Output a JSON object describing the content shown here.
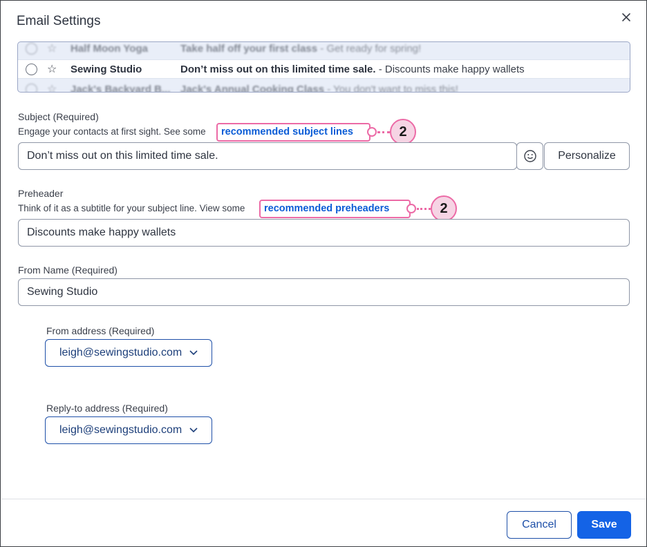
{
  "dialog": {
    "title": "Email Settings"
  },
  "preview": {
    "rows": [
      {
        "sender": "Half Moon Yoga",
        "subject": "Take half off your first class",
        "preheader": " - Get ready for spring!"
      },
      {
        "sender": "Sewing Studio",
        "subject": "Don’t miss out on this limited time sale.",
        "preheader": " - Discounts make happy wallets"
      },
      {
        "sender": "Jack's Backyard B...",
        "subject": "Jack's Annual Cooking Class",
        "preheader": " - You don't want to miss this!"
      }
    ]
  },
  "subject": {
    "label": "Subject",
    "required": "(Required)",
    "help": "Engage your contacts at first sight. See some",
    "link": "recommended subject lines",
    "value": "Don’t miss out on this limited time sale.",
    "callout": "2"
  },
  "personalize_label": "Personalize",
  "preheader": {
    "label": "Preheader",
    "help": "Think of it as a subtitle for your subject line. View some",
    "link": "recommended preheaders",
    "value": "Discounts make happy wallets",
    "callout": "2"
  },
  "from_name": {
    "label": "From Name",
    "required": "(Required)",
    "value": "Sewing Studio"
  },
  "from_address": {
    "label": "From address",
    "required": "(Required)",
    "value": "leigh@sewingstudio.com"
  },
  "reply_to": {
    "label": "Reply-to address",
    "required": "(Required)",
    "value": "leigh@sewingstudio.com"
  },
  "footer": {
    "cancel": "Cancel",
    "save": "Save"
  },
  "colors": {
    "accent": "#1463e6",
    "link": "#0b5cd6",
    "callout": "#ec6aa6"
  }
}
